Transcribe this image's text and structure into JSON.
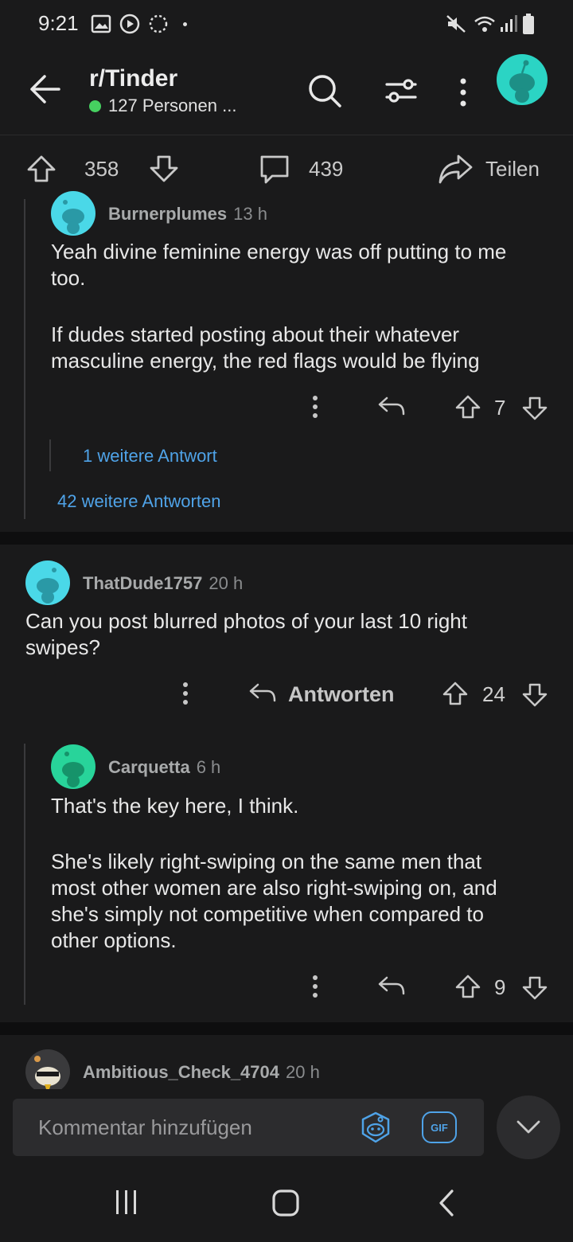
{
  "status_bar": {
    "time": "9:21"
  },
  "header": {
    "subreddit": "r/Tinder",
    "online_text": "127 Personen ..."
  },
  "post_bar": {
    "votes": "358",
    "comments": "439",
    "share_label": "Teilen"
  },
  "comments": [
    {
      "username": "Burnerplumes",
      "age": "13 h",
      "lines": [
        "Yeah divine feminine energy was off putting to me",
        "too.",
        "If dudes started posting about their whatever",
        "masculine energy, the red flags would be flying"
      ],
      "votes": "7",
      "more_replies": "1 weitere Antwort",
      "thread_more": "42 weitere Antworten"
    },
    {
      "username": "ThatDude1757",
      "age": "20 h",
      "lines": [
        "Can you post blurred photos of your last 10 right",
        "swipes?"
      ],
      "reply_label": "Antworten",
      "votes": "24"
    },
    {
      "username": "Carquetta",
      "age": "6 h",
      "lines": [
        "That's the key here, I think.",
        "She's likely right-swiping on the same men that",
        "most other women are also right-swiping on, and",
        "she's simply not competitive when compared to",
        "other options."
      ],
      "votes": "9"
    },
    {
      "username": "Ambitious_Check_4704",
      "age": "20 h"
    }
  ],
  "composer": {
    "placeholder": "Kommentar hinzufügen",
    "gif_label": "GIF"
  },
  "colors": {
    "background": "#1a1a1b",
    "accent_blue": "#4fa3e8",
    "online_green": "#46d160",
    "avatar_teal": "#29c4c4"
  }
}
